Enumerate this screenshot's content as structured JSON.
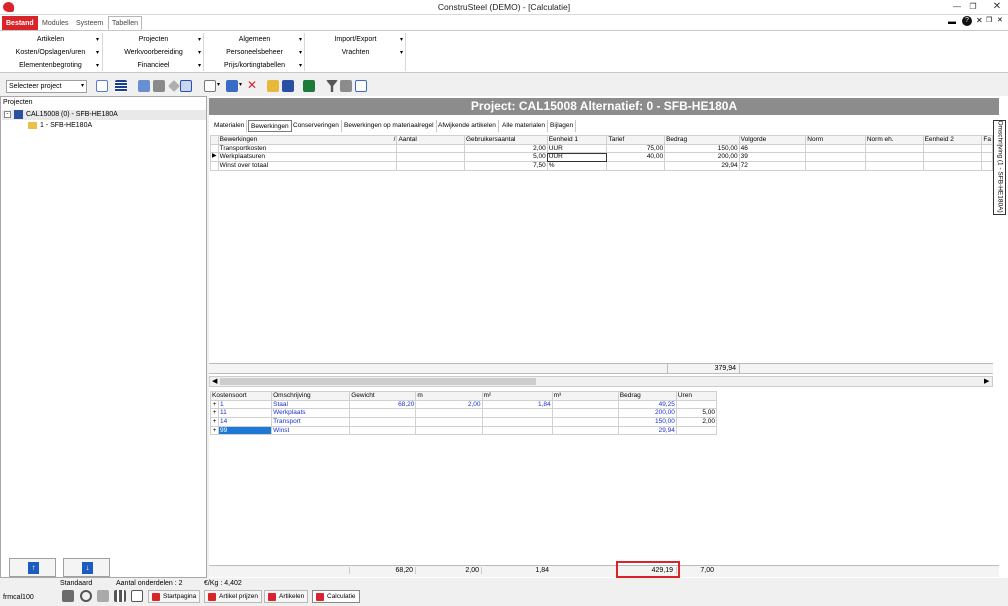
{
  "window": {
    "title": "ConstruSteel (DEMO) - [Calculatie]"
  },
  "menu_tabs": [
    "Bestand",
    "Modules",
    "Systeem",
    "Tabellen"
  ],
  "ribbon": {
    "group1": [
      "Artikelen",
      "Kosten/Opslagen/uren",
      "Elementenbegroting"
    ],
    "group2": [
      "Projecten",
      "Werkvoorbereiding",
      "Financieel"
    ],
    "group3": [
      "Algemeen",
      "Personeelsbeheer",
      "Prijs/kortingtabellen"
    ],
    "group4": [
      "Import/Export",
      "Vrachten"
    ]
  },
  "toolbar": {
    "project_select": "Selecteer project"
  },
  "tree": {
    "header": "Projecten",
    "root": "CAL15008 (0) - SFB-HE180A",
    "child": "1 - SFB-HE180A"
  },
  "banner": "Project: CAL15008 Alternatief: 0 - SFB-HE180A",
  "subtabs": [
    "Materialen",
    "Bewerkingen",
    "Conserveringen",
    "Bewerkingen op materiaalregel",
    "Afwijkende artikelen",
    "Alle materialen",
    "Bijlagen"
  ],
  "vertical_tab": "Omschrijving (1 - SFB-HE180A)",
  "bew_grid": {
    "columns": [
      "Bewerkingen",
      "Aantal",
      "Gebruikersaantal",
      "Eenheid 1",
      "Tarief",
      "Bedrag",
      "Volgorde",
      "Norm",
      "Norm eh.",
      "Eenheid 2",
      "Fa"
    ],
    "rows": [
      [
        "Transportkosten",
        "",
        "2,00",
        "UUR",
        "75,00",
        "150,00",
        "46"
      ],
      [
        "Werkplaatsuren",
        "",
        "5,00",
        "UUR",
        "40,00",
        "200,00",
        "39"
      ],
      [
        "Winst over totaal",
        "",
        "7,50",
        "%",
        "",
        "29,94",
        "72"
      ]
    ],
    "total": "379,94"
  },
  "kost_grid": {
    "columns": [
      "Kostensoort",
      "Omschrijving",
      "Gewicht",
      "m",
      "m²",
      "m³",
      "Bedrag",
      "Uren"
    ],
    "rows": [
      [
        "1",
        "Staal",
        "68,20",
        "2,00",
        "1,84",
        "",
        "49,25",
        ""
      ],
      [
        "11",
        "Werkplaats",
        "",
        "",
        "",
        "",
        "200,00",
        "5,00"
      ],
      [
        "14",
        "Transport",
        "",
        "",
        "",
        "",
        "150,00",
        "2,00"
      ],
      [
        "99",
        "Winst",
        "",
        "",
        "",
        "",
        "29,94",
        ""
      ]
    ],
    "totals": [
      "68,20",
      "2,00",
      "1,84",
      "",
      "429,19",
      "7,00"
    ]
  },
  "status": {
    "standaard": "Standaard",
    "onderdelen": "Aantal onderdelen : 2",
    "perkg": "€/Kg : 4,402",
    "form": "frmcal100"
  },
  "bottom_tabs": [
    "Startpagina",
    "Artikel prijzen",
    "Artikelen",
    "Calculatie"
  ],
  "colors": {
    "accent": "#d9242a",
    "banner": "#8c8c8c",
    "link": "#1a2fd0"
  }
}
